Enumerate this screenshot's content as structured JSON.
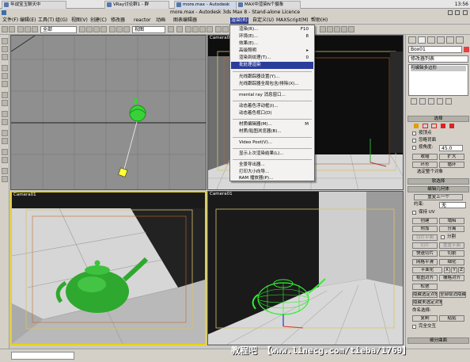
{
  "taskbar": {
    "tasks": [
      "年战宝玉聊天中",
      "VRay讨论群1 - 群",
      "more.max - Autodesk",
      "MAX中渲染N个摄象"
    ],
    "clock": "13:56"
  },
  "window": {
    "title": "more.max - Autodesk 3ds Max 8 - Stand-alone Licence"
  },
  "menubar": [
    "文件(F)",
    "编辑(E)",
    "工具(T)",
    "组(G)",
    "视图(V)",
    "创建(C)",
    "修改器",
    "reactor",
    "动画",
    "图表编辑器",
    "渲染(R)",
    "自定义(U)",
    "MAXScript(M)",
    "帮助(H)"
  ],
  "toolbar": {
    "selection_filter": "全部",
    "view_dropdown": "视图"
  },
  "viewports": {
    "top": {
      "label": ""
    },
    "camera1": {
      "label": "Camera01"
    },
    "front": {
      "label": "Camera01"
    },
    "camera3": {
      "label": "Camera01"
    }
  },
  "render_menu": {
    "items": [
      {
        "label": "渲染(R)...",
        "shortcut": "F10"
      },
      {
        "label": "环境(E)...",
        "shortcut": "8"
      },
      {
        "label": "效果(E)...",
        "shortcut": ""
      },
      {
        "label": "高级照明",
        "shortcut": "▸"
      },
      {
        "label": "渲染到纹理(T)...",
        "shortcut": "0"
      },
      {
        "label": "批处理渲染",
        "shortcut": ""
      },
      {
        "label": "光线跟踪器设置(Y)...",
        "shortcut": ""
      },
      {
        "label": "光线跟踪器全局包含/排除(X)...",
        "shortcut": ""
      },
      {
        "label": "mental ray 消息窗口...",
        "shortcut": ""
      },
      {
        "label": "动态着色浮动框(I)...",
        "shortcut": ""
      },
      {
        "label": "动态着色视口(D)",
        "shortcut": ""
      },
      {
        "label": "材质编辑器(M)...",
        "shortcut": "M"
      },
      {
        "label": "材质/贴图浏览器(B)...",
        "shortcut": ""
      },
      {
        "label": "Video Post(V)...",
        "shortcut": ""
      },
      {
        "label": "显示上次渲染结果(L)...",
        "shortcut": ""
      },
      {
        "label": "全景导出器...",
        "shortcut": ""
      },
      {
        "label": "打印大小向导...",
        "shortcut": ""
      },
      {
        "label": "RAM 播放器(P)...",
        "shortcut": ""
      }
    ]
  },
  "command_panel": {
    "object_name": "Box01",
    "modifier_list": "修改器列表",
    "stack_item": "可编辑多边形",
    "selection": {
      "title": "选择",
      "by_vertex": "按顶点",
      "ignore_backfacing": "忽略背面",
      "by_angle": "按角度:",
      "angle_value": "45.0",
      "shrink": "收缩",
      "grow": "扩大",
      "ring": "环形",
      "loop": "循环",
      "status": "选定整个对象"
    },
    "soft_selection": "软选择",
    "edit_geometry": {
      "title": "编辑几何体",
      "repeat_last": "重复上一个",
      "constraints": "约束:",
      "constraints_value": "无",
      "preserve_uvs": "保持 UV",
      "create": "创建",
      "collapse": "塌陷",
      "attach": "附加",
      "detach": "分离",
      "slice_plane": "切片平面",
      "split": "分割",
      "slice": "切片",
      "reset_plane": "重置平面",
      "quickslice": "快速切片",
      "cut": "切割",
      "meshsmooth": "网格平滑",
      "tessellate": "细化",
      "make_planar": "平面化",
      "x": "X",
      "y": "Y",
      "z": "Z",
      "view_align": "视图对齐",
      "grid_align": "栅格对齐",
      "relax": "松弛",
      "hide_selected": "隐藏选定对象",
      "unhide_all": "全部取消隐藏",
      "hide_unselected": "隐藏未选定对象",
      "named_selections": "命名选择:",
      "copy": "复制",
      "paste": "粘贴",
      "full_interactivity": "完全交互"
    },
    "subdivision_surface": "细分曲面"
  },
  "watermark": "教程吧 【www.linecg.com/tieba/1769】",
  "colors": {
    "menu_highlight": "#2b3d9a",
    "teapot": "#2fb52f",
    "viewport_dark": "#111111"
  }
}
